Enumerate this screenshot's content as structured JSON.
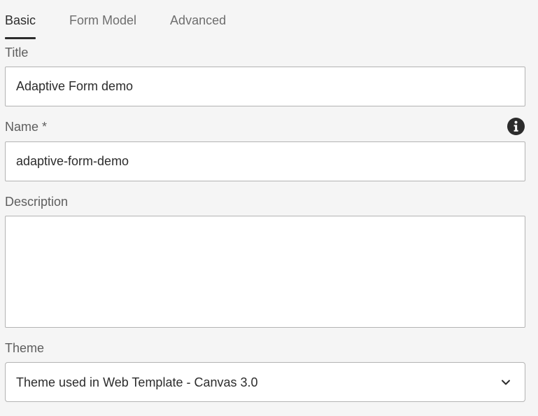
{
  "tabs": [
    {
      "label": "Basic",
      "active": true
    },
    {
      "label": "Form Model",
      "active": false
    },
    {
      "label": "Advanced",
      "active": false
    }
  ],
  "title_field": {
    "label": "Title",
    "value": "Adaptive Form demo"
  },
  "name_field": {
    "label": "Name *",
    "value": "adaptive-form-demo",
    "info_icon": "info-icon"
  },
  "description_field": {
    "label": "Description",
    "value": ""
  },
  "theme_field": {
    "label": "Theme",
    "selected": "Theme used in Web Template - Canvas 3.0",
    "icon": "chevron-down-icon"
  }
}
